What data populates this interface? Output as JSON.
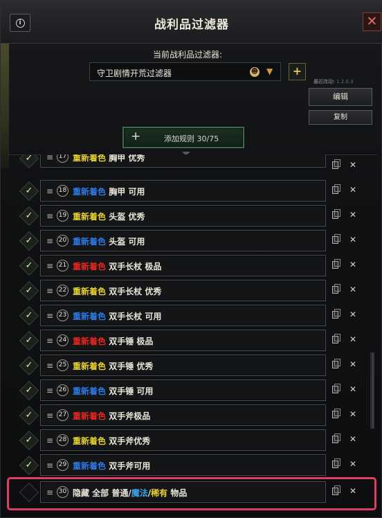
{
  "window": {
    "title": "战利品过滤器",
    "info_icon": "info-icon",
    "close_icon": "close-icon"
  },
  "filter": {
    "current_label": "当前战利品过滤器:",
    "selected": "守卫剧情开荒过滤器",
    "icon": "skull-icon",
    "add_label": "+"
  },
  "side": {
    "last_modified_label": "最近改动:",
    "last_modified_value": "1.2.0.3",
    "edit_label": "编辑",
    "copy_label": "复制"
  },
  "add_rule": {
    "plus": "+",
    "label": "添加规则 30/75"
  },
  "colors": {
    "yellow": "#e8d132",
    "blue": "#2d7ae6",
    "red": "#e8271f",
    "highlight": "#e23b65"
  },
  "rules": [
    {
      "num": "17",
      "action": "重新着色",
      "action_color": "yellow",
      "item": "胸甲 优秀",
      "enabled": true
    },
    {
      "num": "18",
      "action": "重新着色",
      "action_color": "blue",
      "item": "胸甲 可用",
      "enabled": true
    },
    {
      "num": "19",
      "action": "重新着色",
      "action_color": "yellow",
      "item": "头盔 优秀",
      "enabled": true
    },
    {
      "num": "20",
      "action": "重新着色",
      "action_color": "blue",
      "item": "头盔 可用",
      "enabled": true
    },
    {
      "num": "21",
      "action": "重新着色",
      "action_color": "red",
      "item": "双手长杖 极品",
      "enabled": true
    },
    {
      "num": "22",
      "action": "重新着色",
      "action_color": "yellow",
      "item": "双手长杖 优秀",
      "enabled": true
    },
    {
      "num": "23",
      "action": "重新着色",
      "action_color": "blue",
      "item": "双手长杖 可用",
      "enabled": true
    },
    {
      "num": "24",
      "action": "重新着色",
      "action_color": "red",
      "item": "双手锤 极品",
      "enabled": true
    },
    {
      "num": "25",
      "action": "重新着色",
      "action_color": "yellow",
      "item": "双手锤 优秀",
      "enabled": true
    },
    {
      "num": "26",
      "action": "重新着色",
      "action_color": "blue",
      "item": "双手锤 可用",
      "enabled": true
    },
    {
      "num": "27",
      "action": "重新着色",
      "action_color": "red",
      "item": "双手斧极品",
      "enabled": true
    },
    {
      "num": "28",
      "action": "重新着色",
      "action_color": "yellow",
      "item": "双手斧优秀",
      "enabled": true
    },
    {
      "num": "29",
      "action": "重新着色",
      "action_color": "blue",
      "item": "双手斧可用",
      "enabled": true
    }
  ],
  "last_rule": {
    "num": "30",
    "part1": "隐藏 全部 普通/",
    "part2": "魔法",
    "part3": "/",
    "part4": "稀有",
    "part5": " 物品",
    "enabled": false
  },
  "icons": {
    "check": "✓",
    "drag": "≡",
    "delete": "✕",
    "dropdown": "▼"
  }
}
